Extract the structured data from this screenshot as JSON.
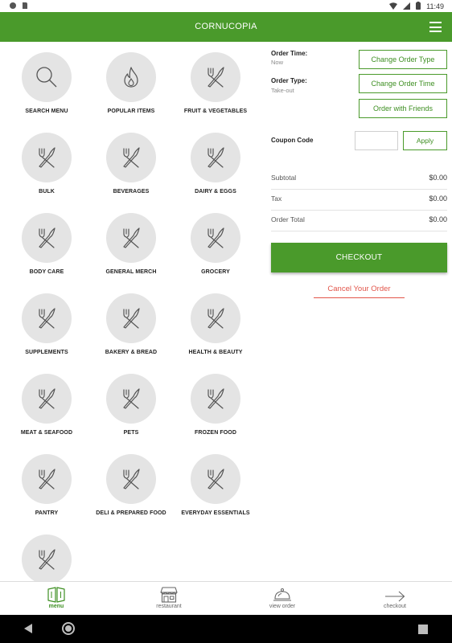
{
  "status_bar": {
    "time": "11:49"
  },
  "app": {
    "title": "CORNUCOPIA"
  },
  "categories": [
    {
      "label": "SEARCH MENU",
      "icon": "search-icon"
    },
    {
      "label": "POPULAR ITEMS",
      "icon": "flame-icon"
    },
    {
      "label": "FRUIT & VEGETABLES",
      "icon": "fork-knife-icon"
    },
    {
      "label": "BULK",
      "icon": "fork-knife-icon"
    },
    {
      "label": "BEVERAGES",
      "icon": "fork-knife-icon"
    },
    {
      "label": "DAIRY & EGGS",
      "icon": "fork-knife-icon"
    },
    {
      "label": "BODY CARE",
      "icon": "fork-knife-icon"
    },
    {
      "label": "GENERAL MERCH",
      "icon": "fork-knife-icon"
    },
    {
      "label": "GROCERY",
      "icon": "fork-knife-icon"
    },
    {
      "label": "SUPPLEMENTS",
      "icon": "fork-knife-icon"
    },
    {
      "label": "BAKERY & BREAD",
      "icon": "fork-knife-icon"
    },
    {
      "label": "HEALTH & BEAUTY",
      "icon": "fork-knife-icon"
    },
    {
      "label": "MEAT & SEAFOOD",
      "icon": "fork-knife-icon"
    },
    {
      "label": "PETS",
      "icon": "fork-knife-icon"
    },
    {
      "label": "FROZEN FOOD",
      "icon": "fork-knife-icon"
    },
    {
      "label": "PANTRY",
      "icon": "fork-knife-icon"
    },
    {
      "label": "DELI & PREPARED FOOD",
      "icon": "fork-knife-icon"
    },
    {
      "label": "EVERYDAY ESSENTIALS",
      "icon": "fork-knife-icon"
    },
    {
      "label": "",
      "icon": "fork-knife-icon"
    }
  ],
  "order": {
    "time_label": "Order Time:",
    "time_value": "Now",
    "type_label": "Order Type:",
    "type_value": "Take-out",
    "change_type_btn": "Change Order Type",
    "change_time_btn": "Change Order Time",
    "friends_btn": "Order with Friends"
  },
  "coupon": {
    "label": "Coupon Code",
    "value": "",
    "apply_btn": "Apply"
  },
  "summary": [
    {
      "label": "Subtotal",
      "value": "$0.00"
    },
    {
      "label": "Tax",
      "value": "$0.00"
    },
    {
      "label": "Order Total",
      "value": "$0.00"
    }
  ],
  "checkout_btn": "CHECKOUT",
  "cancel_link": "Cancel Your Order",
  "bottom_nav": [
    {
      "label": "menu",
      "icon": "menu-book-icon",
      "active": true
    },
    {
      "label": "restaurant",
      "icon": "storefront-icon",
      "active": false
    },
    {
      "label": "view order",
      "icon": "cloche-icon",
      "active": false
    },
    {
      "label": "checkout",
      "icon": "arrow-right-icon",
      "active": false
    }
  ],
  "colors": {
    "brand": "#4a9a2b",
    "cancel": "#e2554a",
    "tile": "#e4e4e4"
  }
}
